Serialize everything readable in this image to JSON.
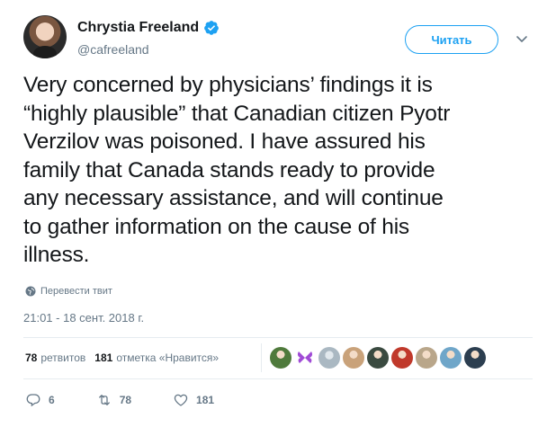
{
  "user": {
    "display_name": "Chrystia Freeland",
    "handle": "@cafreeland",
    "verified": true
  },
  "follow_button": {
    "label": "Читать"
  },
  "tweet": {
    "text": "Very concerned by physicians’ findings it is\n“highly plausible” that Canadian citizen Pyotr\nVerzilov was poisoned. I have assured his\nfamily that Canada stands ready to provide\nany necessary assistance, and will continue\nto gather information on the cause of his\nillness.",
    "translate_label": "Перевести твит",
    "timestamp": "21:01 - 18 сент. 2018 г."
  },
  "stats": {
    "retweets_count": "78",
    "retweets_label": "ретвитов",
    "likes_count": "181",
    "likes_label": "отметка «Нравится»"
  },
  "likers": [
    {
      "icon": "avatar-nature",
      "color": "#4f7a3c"
    },
    {
      "icon": "avatar-butterfly",
      "color": "#a04bd6"
    },
    {
      "icon": "avatar-default",
      "color": "#aab8c2"
    },
    {
      "icon": "avatar-person",
      "color": "#c9a27a"
    },
    {
      "icon": "avatar-person-dark",
      "color": "#3a4a40"
    },
    {
      "icon": "avatar-flag",
      "color": "#c0392b"
    },
    {
      "icon": "avatar-photo",
      "color": "#b9a68a"
    },
    {
      "icon": "avatar-sea",
      "color": "#6fa6c9"
    },
    {
      "icon": "avatar-suit",
      "color": "#2c3e50"
    }
  ],
  "actions": {
    "replies": "6",
    "retweets": "78",
    "likes": "181"
  },
  "colors": {
    "accent": "#1da1f2",
    "text": "#14171a",
    "muted": "#657786"
  }
}
